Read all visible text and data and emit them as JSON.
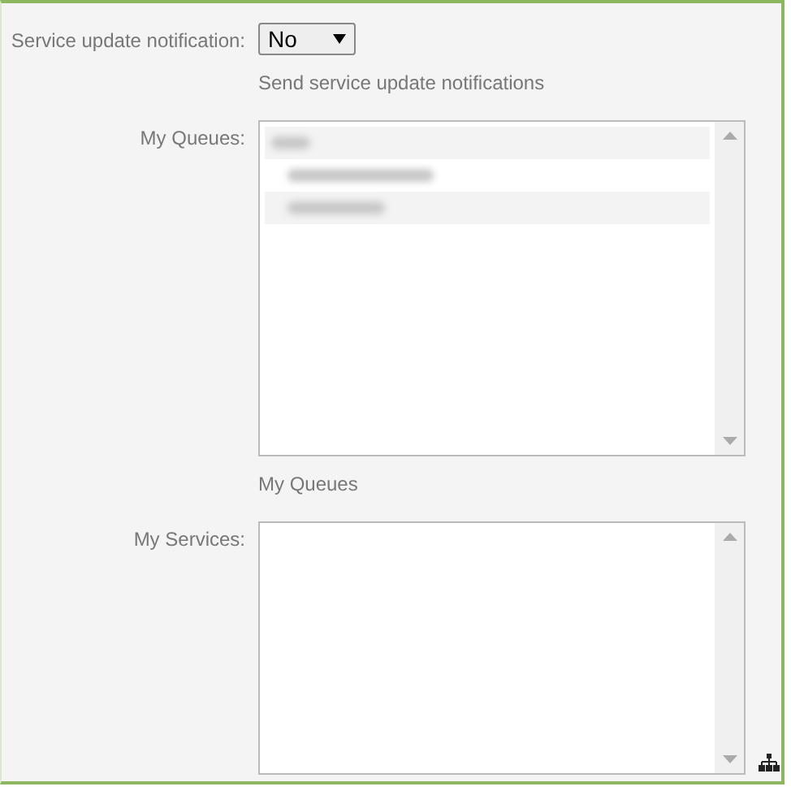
{
  "fields": [
    {
      "kind": "select",
      "label": "Service update notification:",
      "value": "No",
      "hint": "Send service update notifications"
    },
    {
      "kind": "list",
      "label": "My Queues:",
      "hint": "My Queues",
      "items": [
        {
          "kind": "redacted",
          "children": [
            {
              "kind": "redacted"
            },
            {
              "kind": "redacted"
            }
          ]
        }
      ]
    },
    {
      "kind": "list",
      "label": "My Services:",
      "tree_button": true
    }
  ]
}
